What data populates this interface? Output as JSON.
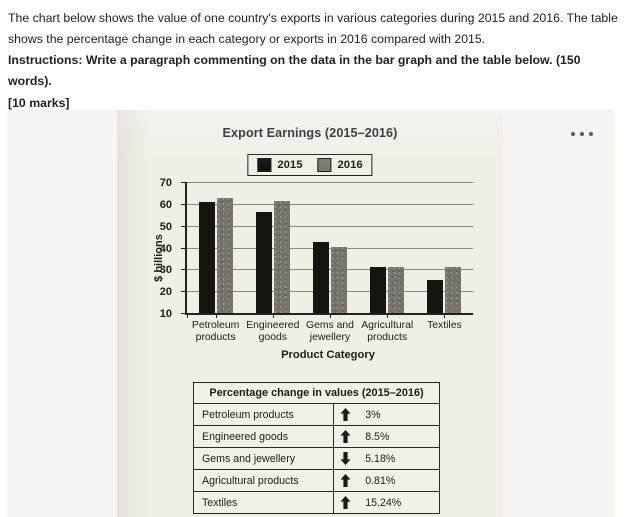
{
  "prompt": {
    "line1": "The chart below shows the value of one country's exports in various categories during 2015 and 2016. The table shows the percentage change in each category or exports in 2016 compared with 2015.",
    "instructions": "Instructions: Write a paragraph commenting on the data in the bar graph and the table below. (150 words).",
    "marks": "[10 marks]"
  },
  "card": {
    "menu_icon": "more-options-icon"
  },
  "chart_data": {
    "type": "bar",
    "title": "Export Earnings (2015–2016)",
    "xlabel": "Product Category",
    "ylabel": "$ billions",
    "ylim": [
      10,
      70
    ],
    "yticks": [
      10,
      20,
      30,
      40,
      50,
      60,
      70
    ],
    "grid": true,
    "legend_position": "top-center",
    "categories": [
      "Petroleum products",
      "Engineered goods",
      "Gems and jewellery",
      "Agricultural products",
      "Textiles"
    ],
    "category_lines": [
      [
        "Petroleum",
        "products"
      ],
      [
        "Engineered",
        "goods"
      ],
      [
        "Gems and",
        "jewellery"
      ],
      [
        "Agricultural",
        "products"
      ],
      [
        "Textiles"
      ]
    ],
    "series": [
      {
        "name": "2015",
        "color": "#15140f",
        "values": [
          60.8,
          56.4,
          42.4,
          30.9,
          25.2
        ]
      },
      {
        "name": "2016",
        "color": "#76746a",
        "values": [
          62.8,
          61.2,
          40.2,
          31.3,
          31.3
        ]
      }
    ]
  },
  "table": {
    "caption": "Percentage change in values (2015–2016)",
    "rows": [
      {
        "category": "Petroleum products",
        "direction": "up",
        "value": "3%"
      },
      {
        "category": "Engineered goods",
        "direction": "up",
        "value": "8.5%"
      },
      {
        "category": "Gems and jewellery",
        "direction": "down",
        "value": "5.18%"
      },
      {
        "category": "Agricultural products",
        "direction": "up",
        "value": "0.81%"
      },
      {
        "category": "Textiles",
        "direction": "up",
        "value": "15.24%"
      }
    ]
  }
}
